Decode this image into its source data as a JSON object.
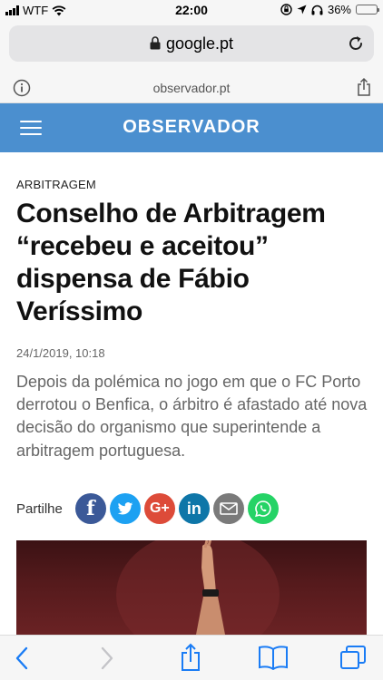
{
  "status_bar": {
    "carrier": "WTF",
    "time": "22:00",
    "battery_percent": "36%",
    "battery_level": 0.36,
    "icons": [
      "signal-icon",
      "wifi-icon",
      "rotation-lock-icon",
      "location-icon",
      "headphones-icon",
      "battery-icon"
    ]
  },
  "browser": {
    "url": "google.pt",
    "site": "observador.pt",
    "icons": [
      "lock-icon",
      "reload-icon",
      "info-icon",
      "share-icon"
    ]
  },
  "header": {
    "logo": "OBSERVADOR",
    "background": "#4b8fcf",
    "icons": [
      "hamburger-menu-icon"
    ]
  },
  "article": {
    "section": "ARBITRAGEM",
    "headline": "Conselho de Arbitragem “recebeu e aceitou” dispensa de Fábio Veríssimo",
    "date": "24/1/2019, 10:18",
    "lead": "Depois da polémica no jogo em que o FC Porto derrotou o Benfica, o árbitro é afastado até nova decisão do organismo que superintende a arbitragem portuguesa."
  },
  "share": {
    "label": "Partilhe",
    "buttons": [
      {
        "name": "facebook",
        "glyph": "f",
        "color": "#3b5998"
      },
      {
        "name": "twitter",
        "glyph": "",
        "color": "#1da1f2"
      },
      {
        "name": "google-plus",
        "glyph": "G+",
        "color": "#dd4b39"
      },
      {
        "name": "linkedin",
        "glyph": "in",
        "color": "#0e76a8"
      },
      {
        "name": "email",
        "glyph": "",
        "color": "#7a7a7a"
      },
      {
        "name": "whatsapp",
        "glyph": "",
        "color": "#25d366"
      }
    ]
  },
  "toolbar": {
    "icons": [
      "back-icon",
      "forward-icon",
      "share-icon",
      "bookmarks-icon",
      "tabs-icon"
    ],
    "accent": "#1a7cf5"
  }
}
